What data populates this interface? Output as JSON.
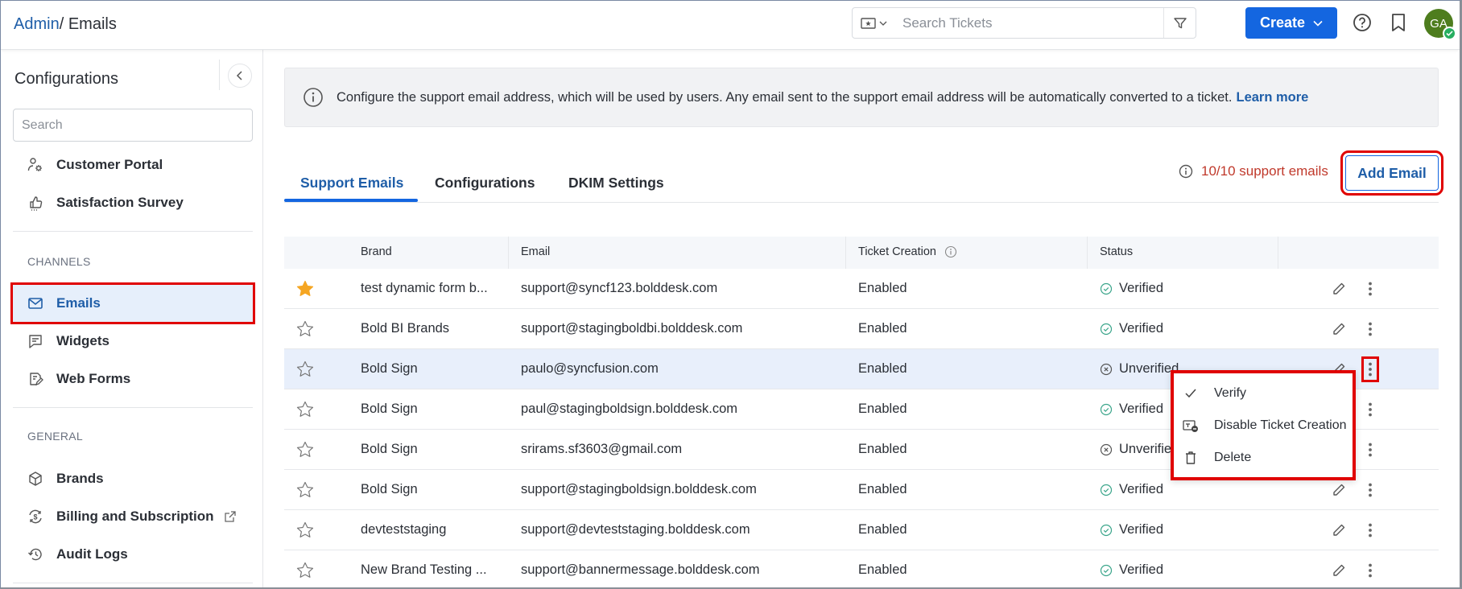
{
  "header": {
    "breadcrumb_root": "Admin",
    "breadcrumb_sep": "/ ",
    "breadcrumb_current": "Emails",
    "search_placeholder": "Search Tickets",
    "create_label": "Create",
    "avatar_initials": "GA",
    "accent_color": "#1466e0"
  },
  "sidebar": {
    "title": "Configurations",
    "search_placeholder": "Search",
    "top_items": [
      {
        "label": "Customer Portal",
        "icon": "user-gear-icon"
      },
      {
        "label": "Satisfaction Survey",
        "icon": "thumbs-up-icon"
      }
    ],
    "channels_heading": "CHANNELS",
    "channel_items": [
      {
        "label": "Emails",
        "icon": "mail-icon",
        "active": true
      },
      {
        "label": "Widgets",
        "icon": "widget-icon"
      },
      {
        "label": "Web Forms",
        "icon": "web-form-icon"
      }
    ],
    "general_heading": "GENERAL",
    "general_items": [
      {
        "label": "Brands",
        "icon": "cube-icon"
      },
      {
        "label": "Billing and Subscription",
        "icon": "billing-icon",
        "external": true
      },
      {
        "label": "Audit Logs",
        "icon": "history-icon"
      }
    ]
  },
  "banner": {
    "text": "Configure the support email address, which will be used by users. Any email sent to the support email address will be automatically converted to a ticket.",
    "link": "Learn more"
  },
  "tabs": [
    {
      "label": "Support Emails",
      "active": true
    },
    {
      "label": "Configurations"
    },
    {
      "label": "DKIM Settings"
    }
  ],
  "limit_text": "10/10 support emails",
  "add_email_label": "Add Email",
  "table": {
    "columns": [
      "Brand",
      "Email",
      "Ticket Creation",
      "Status"
    ],
    "rows": [
      {
        "favorite": true,
        "brand": "test dynamic form b...",
        "email": "support@syncf123.bolddesk.com",
        "ticket_creation": "Enabled",
        "status": "Verified"
      },
      {
        "favorite": false,
        "brand": "Bold BI Brands",
        "email": "support@stagingboldbi.bolddesk.com",
        "ticket_creation": "Enabled",
        "status": "Verified"
      },
      {
        "favorite": false,
        "brand": "Bold Sign",
        "email": "paulo@syncfusion.com",
        "ticket_creation": "Enabled",
        "status": "Unverified",
        "selected": true
      },
      {
        "favorite": false,
        "brand": "Bold Sign",
        "email": "paul@stagingboldsign.bolddesk.com",
        "ticket_creation": "Enabled",
        "status": "Verified"
      },
      {
        "favorite": false,
        "brand": "Bold Sign",
        "email": "srirams.sf3603@gmail.com",
        "ticket_creation": "Enabled",
        "status": "Unverified"
      },
      {
        "favorite": false,
        "brand": "Bold Sign",
        "email": "support@stagingboldsign.bolddesk.com",
        "ticket_creation": "Enabled",
        "status": "Verified"
      },
      {
        "favorite": false,
        "brand": "devteststaging",
        "email": "support@devteststaging.bolddesk.com",
        "ticket_creation": "Enabled",
        "status": "Verified"
      },
      {
        "favorite": false,
        "brand": "New Brand Testing ...",
        "email": "support@bannermessage.bolddesk.com",
        "ticket_creation": "Enabled",
        "status": "Verified"
      }
    ]
  },
  "context_menu": {
    "items": [
      {
        "label": "Verify",
        "icon": "check-icon"
      },
      {
        "label": "Disable Ticket Creation",
        "icon": "disable-ticket-icon"
      },
      {
        "label": "Delete",
        "icon": "trash-icon"
      }
    ]
  },
  "colors": {
    "verified": "#3aa58a",
    "unverified": "#555555",
    "star_filled": "#f5a623",
    "limit_warning": "#c0392b",
    "highlight": "#e00000"
  }
}
